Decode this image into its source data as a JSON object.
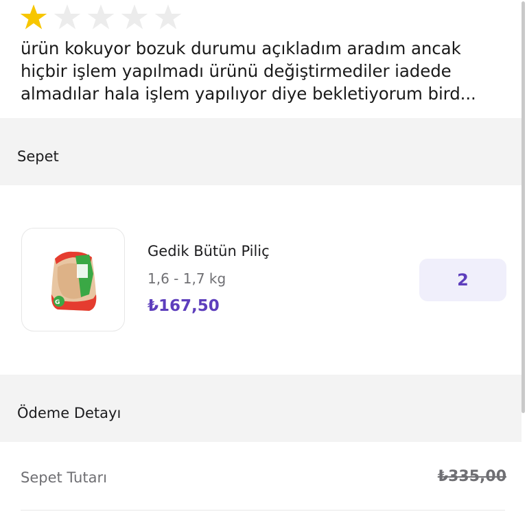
{
  "review": {
    "rating": 1,
    "max_rating": 5,
    "text": "ürün kokuyor bozuk durumu açıkladım aradım ancak hiçbir işlem yapılmadı ürünü değiştirmediler iadede almadılar hala işlem yapılıyor diye bekletiyorum bird..."
  },
  "cart": {
    "header": "Sepet",
    "item": {
      "name": "Gedik Bütün Piliç",
      "weight": "1,6 - 1,7 kg",
      "price": "₺167,50",
      "quantity": "2",
      "image_icon": "whole-chicken-package-image"
    }
  },
  "payment": {
    "header": "Ödeme Detayı",
    "basket_total_label": "Sepet Tutarı",
    "basket_total_value": "₺335,00"
  },
  "colors": {
    "accent": "#5d3ebc",
    "star_filled": "#f7c600",
    "star_empty": "#ececec",
    "section_bg": "#f3f3f3",
    "qty_bg": "#f0effb"
  }
}
